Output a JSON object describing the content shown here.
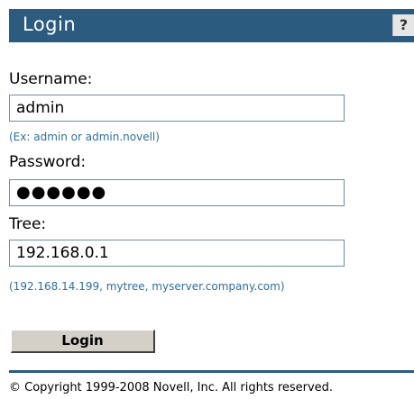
{
  "header": {
    "title": "Login",
    "help_label": "?"
  },
  "form": {
    "username": {
      "label": "Username:",
      "value": "admin",
      "hint": "(Ex: admin or admin.novell)"
    },
    "password": {
      "label": "Password:",
      "masked_value": "●●●●●●"
    },
    "tree": {
      "label": "Tree:",
      "value": "192.168.0.1",
      "hint": "(192.168.14.199, mytree, myserver.company.com)"
    },
    "login_label": "Login"
  },
  "footer": {
    "copyright": "© Copyright 1999-2008 Novell, Inc. All rights reserved."
  },
  "colors": {
    "header_background": "#2b5b7f",
    "hint_text": "#2e6ea0",
    "button_face": "#d4d0c8"
  }
}
